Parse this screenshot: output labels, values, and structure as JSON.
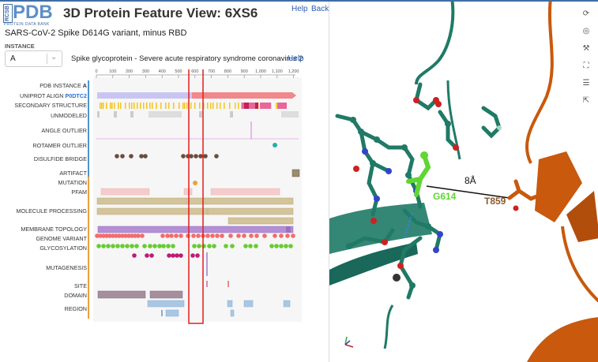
{
  "logo": {
    "side": "RCSB",
    "main": "PDB",
    "sub": "PROTEIN DATA BANK"
  },
  "header": {
    "title": "3D Protein Feature View: 6XS6",
    "help": "Help",
    "back": "Back"
  },
  "subtitle": "SARS-CoV-2 Spike D614G variant, minus RBD",
  "instance": {
    "label": "INSTANCE",
    "value": "A",
    "entity": "Spike glycoprotein - Severe acute respiratory syndrome coronavirus 2",
    "help": "Help"
  },
  "axis": {
    "ticks": [
      "0",
      "100",
      "200",
      "300",
      "400",
      "500",
      "600",
      "700",
      "800",
      "900",
      "1,000",
      "1,100",
      "1,200"
    ]
  },
  "rows": {
    "pdb_instance_prefix": "PDB INSTANCE",
    "pdb_instance_value": "A",
    "uniprot_prefix": "UNIPROT ALIGN",
    "uniprot_acc": "P0DTC2",
    "secondary": "SECONDARY STRUCTURE",
    "unmodeled": "UNMODELED",
    "angle": "ANGLE OUTLIER",
    "rotamer": "ROTAMER OUTLIER",
    "disulfide": "DISULFIDE BRIDGE",
    "artifact": "ARTIFACT",
    "mutation": "MUTATION",
    "pfam": "PFAM",
    "molproc": "MOLECULE PROCESSING",
    "membrane": "MEMBRANE TOPOLOGY",
    "genome": "GENOME VARIANT",
    "glyco": "GLYCOSYLATION",
    "mutagenesis": "MUTAGENESIS",
    "site": "SITE",
    "domain": "DOMAIN",
    "region": "REGION"
  },
  "viewer": {
    "labels": {
      "g614": "G614",
      "t859": "T859",
      "distance": "8Å"
    },
    "colors": {
      "teal": "#1f7a66",
      "orange": "#c8590d",
      "green": "#5fd631",
      "brown": "#8a5a2b"
    },
    "tools": [
      "refresh-icon",
      "target-icon",
      "wrench-icon",
      "expand-icon",
      "sliders-icon",
      "pointer-icon"
    ]
  },
  "colors": {
    "uniprot_left": "#c9c5f3",
    "uniprot_right": "#f0888c",
    "molproc": "#d4c49a",
    "membrane": "#b58fd6",
    "genome": "#f26c6c",
    "glyco": "#66cc33",
    "mutagenesis": "#c0197a",
    "domain": "#a58e9e",
    "region": "#a9c7e5",
    "selection": "#e51c1c"
  }
}
